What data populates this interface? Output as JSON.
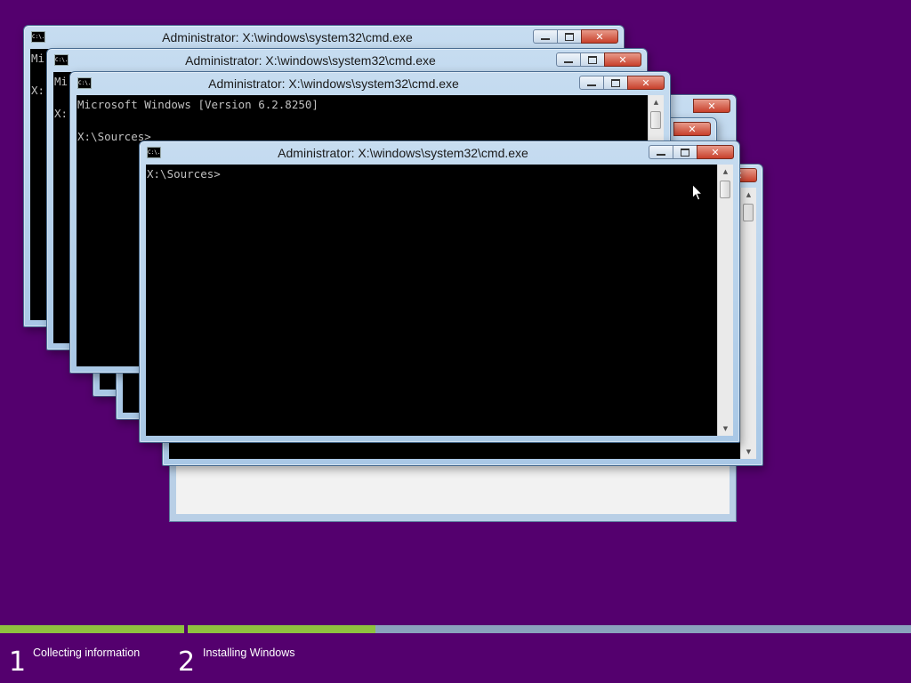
{
  "desktop": {
    "background_color": "#54006e"
  },
  "windows": {
    "w1": {
      "title": "Administrator: X:\\windows\\system32\\cmd.exe",
      "icon_text": "C:\\.",
      "console_text": "Mi\n\nX:"
    },
    "w2": {
      "title": "Administrator: X:\\windows\\system32\\cmd.exe",
      "icon_text": "C:\\.",
      "console_text": "Mi\n\nX:"
    },
    "w3": {
      "title": "Administrator: X:\\windows\\system32\\cmd.exe",
      "icon_text": "C:\\.",
      "console_text": "Microsoft Windows [Version 6.2.8250]\n\nX:\\Sources>"
    },
    "w4": {
      "title": "Administrator: X:\\windows\\system32\\cmd.exe",
      "icon_text": "C:\\.",
      "console_text": "X:\\Sources>"
    },
    "close_glyph": "✕"
  },
  "setup": {
    "steps": [
      {
        "number": "1",
        "label": "Collecting information",
        "progress": 1.0
      },
      {
        "number": "2",
        "label": "Installing Windows",
        "progress": 0.26
      }
    ],
    "colors": {
      "progress_fill": "#8fc13f",
      "progress_track": "#8aa2bd"
    }
  }
}
